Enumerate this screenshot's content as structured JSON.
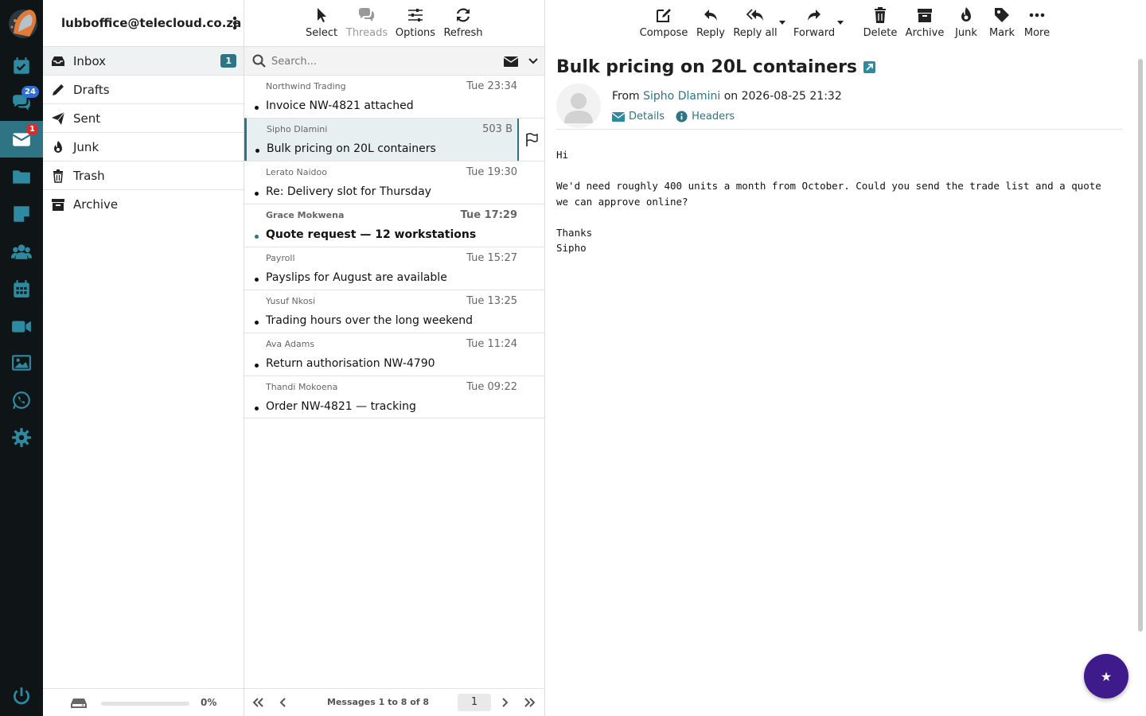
{
  "rail": {
    "chat_badge": "24",
    "mail_badge": "1",
    "items": [
      "tasks",
      "chat",
      "mail",
      "files",
      "notes",
      "contacts",
      "calendar",
      "video",
      "photos",
      "whatsapp",
      "settings",
      "logout"
    ]
  },
  "folders": {
    "account": "lubboffice@telecloud.co.za",
    "items": [
      {
        "label": "Inbox",
        "count": "1"
      },
      {
        "label": "Drafts"
      },
      {
        "label": "Sent"
      },
      {
        "label": "Junk"
      },
      {
        "label": "Trash"
      },
      {
        "label": "Archive"
      }
    ],
    "quota_percent": "0%"
  },
  "list_toolbar": {
    "select": "Select",
    "threads": "Threads",
    "options": "Options",
    "refresh": "Refresh"
  },
  "search": {
    "placeholder": "Search..."
  },
  "messages": [
    {
      "from": "Northwind Trading",
      "date": "Tue 23:34",
      "subject": "Invoice NW-4821 attached",
      "unread": false,
      "selected": false
    },
    {
      "from": "Sipho Dlamini",
      "date": "503 B",
      "subject": "Bulk pricing on 20L containers",
      "unread": false,
      "selected": true
    },
    {
      "from": "Lerato Naidoo",
      "date": "Tue 19:30",
      "subject": "Re: Delivery slot for Thursday",
      "unread": false,
      "selected": false
    },
    {
      "from": "Grace Mokwena",
      "date": "Tue 17:29",
      "subject": "Quote request — 12 workstations",
      "unread": true,
      "selected": false
    },
    {
      "from": "Payroll",
      "date": "Tue 15:27",
      "subject": "Payslips for August are available",
      "unread": false,
      "selected": false
    },
    {
      "from": "Yusuf Nkosi",
      "date": "Tue 13:25",
      "subject": "Trading hours over the long weekend",
      "unread": false,
      "selected": false
    },
    {
      "from": "Ava Adams",
      "date": "Tue 11:24",
      "subject": "Return authorisation NW-4790",
      "unread": false,
      "selected": false
    },
    {
      "from": "Thandi Mokoena",
      "date": "Tue 09:22",
      "subject": "Order NW-4821 — tracking",
      "unread": false,
      "selected": false
    }
  ],
  "pager": {
    "info": "Messages 1 to 8 of 8",
    "page": "1"
  },
  "read_toolbar": {
    "compose": "Compose",
    "reply": "Reply",
    "reply_all": "Reply all",
    "forward": "Forward",
    "delete": "Delete",
    "archive": "Archive",
    "junk": "Junk",
    "mark": "Mark",
    "more": "More"
  },
  "message": {
    "subject": "Bulk pricing on 20L containers",
    "from_prefix": "From",
    "from_name": "Sipho Dlamini",
    "date_text": "on 2026-08-25 21:32",
    "details": "Details",
    "headers": "Headers",
    "body": "Hi\n\nWe'd need roughly 400 units a month from October. Could you send the trade list and a quote\nwe can approve online?\n\nThanks\nSipho"
  },
  "colors": {
    "accent": "#2e7485",
    "rail_bg": "#0f1416",
    "fab": "#3e1a8a"
  }
}
